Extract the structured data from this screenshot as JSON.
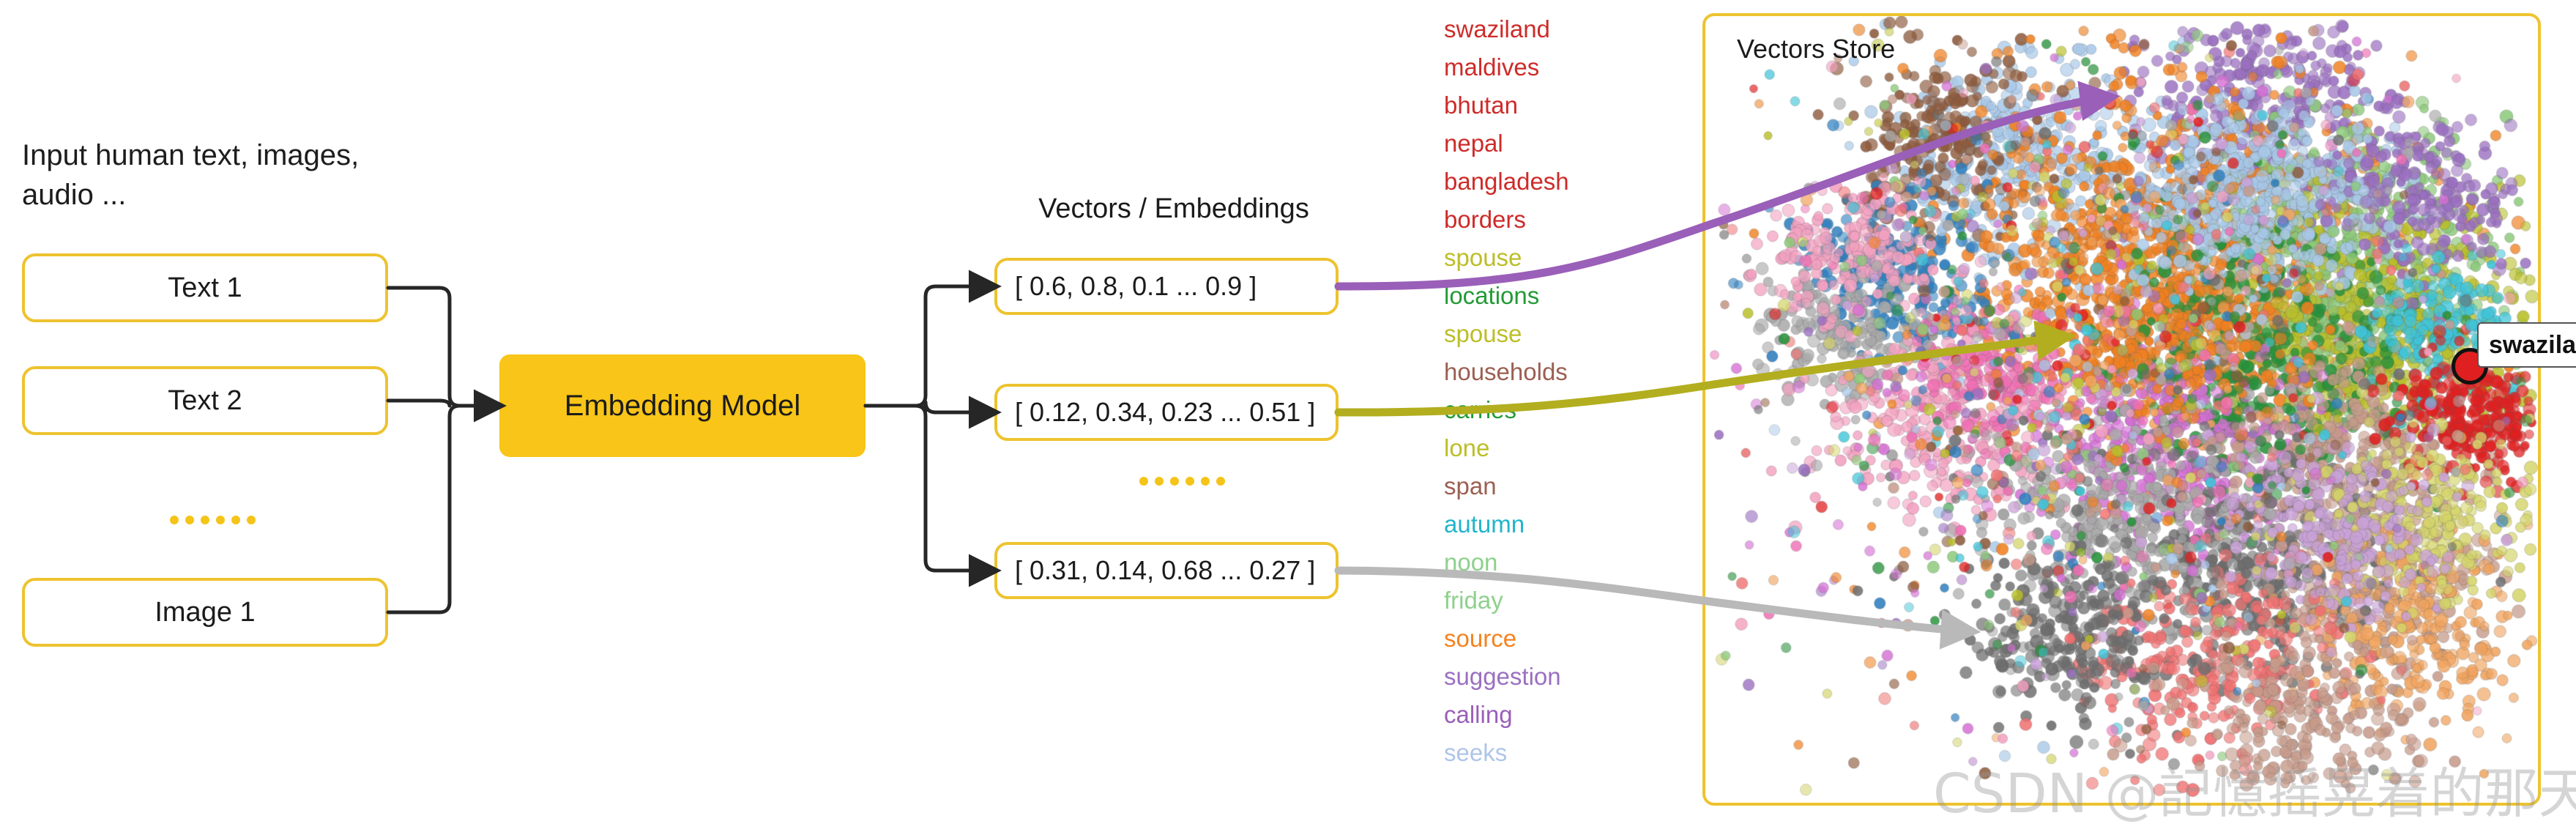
{
  "input": {
    "caption": "Input human text, images,\naudio ...",
    "items": [
      {
        "label": "Text 1"
      },
      {
        "label": "Text 2"
      },
      {
        "label": "Image 1"
      }
    ],
    "ellipsis": "......"
  },
  "model": {
    "label": "Embedding Model",
    "fill": "#f8c518"
  },
  "vectors": {
    "title": "Vectors / Embeddings",
    "ellipsis": "......",
    "items": [
      {
        "label": "[ 0.6, 0.8, 0.1 ... 0.9 ]",
        "connector_color": "#9a5fb8"
      },
      {
        "label": "[ 0.12, 0.34, 0.23 ... 0.51 ]",
        "connector_color": "#b2ae1f"
      },
      {
        "label": "[ 0.31, 0.14, 0.68 ... 0.27 ]",
        "connector_color": "#b9b9b9"
      }
    ]
  },
  "word_list": [
    {
      "text": "swaziland",
      "color": "#ce2b28"
    },
    {
      "text": "maldives",
      "color": "#ce2b28"
    },
    {
      "text": "bhutan",
      "color": "#ce2b28"
    },
    {
      "text": "nepal",
      "color": "#ce2b28"
    },
    {
      "text": "bangladesh",
      "color": "#ce2b28"
    },
    {
      "text": "borders",
      "color": "#ce2b28"
    },
    {
      "text": "spouse",
      "color": "#bcbe27"
    },
    {
      "text": "locations",
      "color": "#229b35"
    },
    {
      "text": "spouse",
      "color": "#bcbe27"
    },
    {
      "text": "households",
      "color": "#9b5f52"
    },
    {
      "text": "carries",
      "color": "#229b35"
    },
    {
      "text": "lone",
      "color": "#bcbe27"
    },
    {
      "text": "span",
      "color": "#9b5f52"
    },
    {
      "text": "autumn",
      "color": "#21b4cc"
    },
    {
      "text": "noon",
      "color": "#8dd18c"
    },
    {
      "text": "friday",
      "color": "#8dd18c"
    },
    {
      "text": "source",
      "color": "#f5821f"
    },
    {
      "text": "suggestion",
      "color": "#9a6fc0"
    },
    {
      "text": "calling",
      "color": "#9a5fb8"
    },
    {
      "text": "seeks",
      "color": "#aec5e8"
    }
  ],
  "store": {
    "title": "Vectors Store",
    "border_color": "#edc32f",
    "highlight": {
      "label": "swaziland",
      "dot_color": "#e02020"
    }
  },
  "watermark": {
    "text": "CSDN @記憶摇晃着的那天"
  },
  "chart_data": {
    "type": "scatter",
    "title": "Vectors Store",
    "xlabel": "",
    "ylabel": "",
    "grid": false,
    "legend": "none",
    "annotations": [
      "swaziland"
    ],
    "description": "t-SNE style embedding projection: ~6000 semi-transparent points in many colored clusters",
    "cluster_colors": [
      "#f08020",
      "#a8c8e8",
      "#8d5a3c",
      "#9a6fc0",
      "#b9bf2a",
      "#8cc97a",
      "#27913a",
      "#2f7fbf",
      "#ef6fb4",
      "#f3a1c0",
      "#a9a9a9",
      "#6e6e6e",
      "#e02020",
      "#3fc4d8",
      "#c9a2d8",
      "#f0a35e",
      "#d4d46a",
      "#c69a8a",
      "#f07070",
      "#d46fd4"
    ]
  }
}
